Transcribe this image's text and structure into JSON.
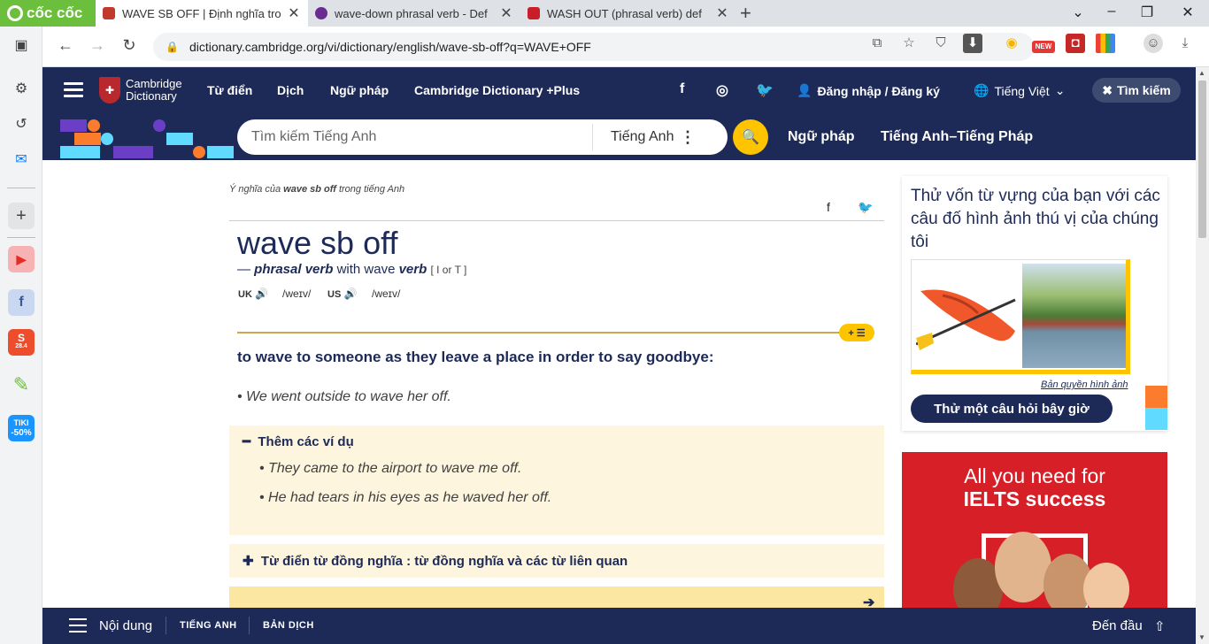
{
  "browser": {
    "brand": "cốc cốc",
    "tabs": [
      {
        "title": "WAVE SB OFF | Định nghĩa trong",
        "fav": "#c0392b"
      },
      {
        "title": "wave-down phrasal verb - Def",
        "fav": "#6a2c91"
      },
      {
        "title": "WASH OUT (phrasal verb) def",
        "fav": "#c81e2a"
      }
    ],
    "url": "dictionary.cambridge.org/vi/dictionary/english/wave-sb-off?q=WAVE+OFF",
    "new_badge": "NEW",
    "sidebar_apps": {
      "shopee_badge": "28.4",
      "tiki": "TIKI",
      "tiki_sub": "-50%"
    }
  },
  "site": {
    "logo_line1": "Cambridge",
    "logo_line2": "Dictionary",
    "nav": {
      "dictionary": "Từ điển",
      "translate": "Dịch",
      "grammar": "Ngữ pháp",
      "plus": "Cambridge Dictionary +Plus",
      "login": "Đăng nhập / Đăng ký",
      "language": "Tiếng Việt",
      "search_toggle": "Tìm kiếm"
    },
    "search": {
      "placeholder": "Tìm kiếm Tiếng Anh",
      "language": "Tiếng Anh",
      "link_grammar": "Ngữ pháp",
      "link_en_fr": "Tiếng Anh–Tiếng Pháp"
    }
  },
  "entry": {
    "crumb_prefix": "Ý nghĩa của",
    "crumb_word": "wave sb off",
    "crumb_suffix": "trong tiếng Anh",
    "headword": "wave sb off",
    "pos_dash": "—",
    "pos_label": "phrasal verb",
    "pos_with": "with wave",
    "pos_verb": "verb",
    "grammar_code": "[ I or T ]",
    "uk_label": "UK",
    "uk_ipa": "/weɪv/",
    "us_label": "US",
    "us_ipa": "/weɪv/",
    "plus_pill": "+ ☰",
    "definition": "to wave to someone as they leave a place in order to say goodbye:",
    "example_main": "We went outside to wave her off.",
    "more_title": "Thêm các ví dụ",
    "more_examples": [
      "They came to the airport to wave me off.",
      "He had tears in his eyes as he waved her off."
    ],
    "synonyms_title": "Từ điển từ đồng nghĩa : từ đồng nghĩa và các từ liên quan"
  },
  "quiz": {
    "text": "Thử vốn từ vựng của bạn với các câu đố hình ảnh thú vị của chúng tôi",
    "credit": "Bản quyền hình ảnh",
    "button": "Thử một câu hỏi bây giờ"
  },
  "ad": {
    "line1": "All you need for",
    "line2": "IELTS success"
  },
  "bottom": {
    "contents": "Nội dung",
    "english": "TIẾNG ANH",
    "translation": "BẢN DỊCH",
    "top": "Đến đầu"
  },
  "colors": {
    "navy": "#1d2a57",
    "yellow": "#fec400",
    "cream": "#fdf5dd",
    "ad_red": "#d61f26"
  }
}
